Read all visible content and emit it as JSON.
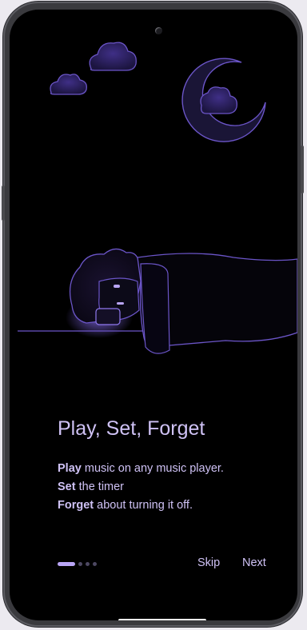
{
  "onboarding": {
    "title": "Play, Set, Forget",
    "lines": [
      {
        "bold": "Play",
        "rest": " music on any music player."
      },
      {
        "bold": "Set",
        "rest": " the timer"
      },
      {
        "bold": "Forget",
        "rest": " about turning it off."
      }
    ],
    "pager": {
      "current": 1,
      "total": 4
    },
    "skip_label": "Skip",
    "next_label": "Next"
  },
  "illustration_icons": [
    "cloud-icon",
    "cloud-icon",
    "moon-icon",
    "sleeping-person-icon"
  ],
  "colors": {
    "accent": "#cfc2f5",
    "accent_strong": "#b9a5f5",
    "outline": "#6b55c8",
    "background": "#000000"
  }
}
